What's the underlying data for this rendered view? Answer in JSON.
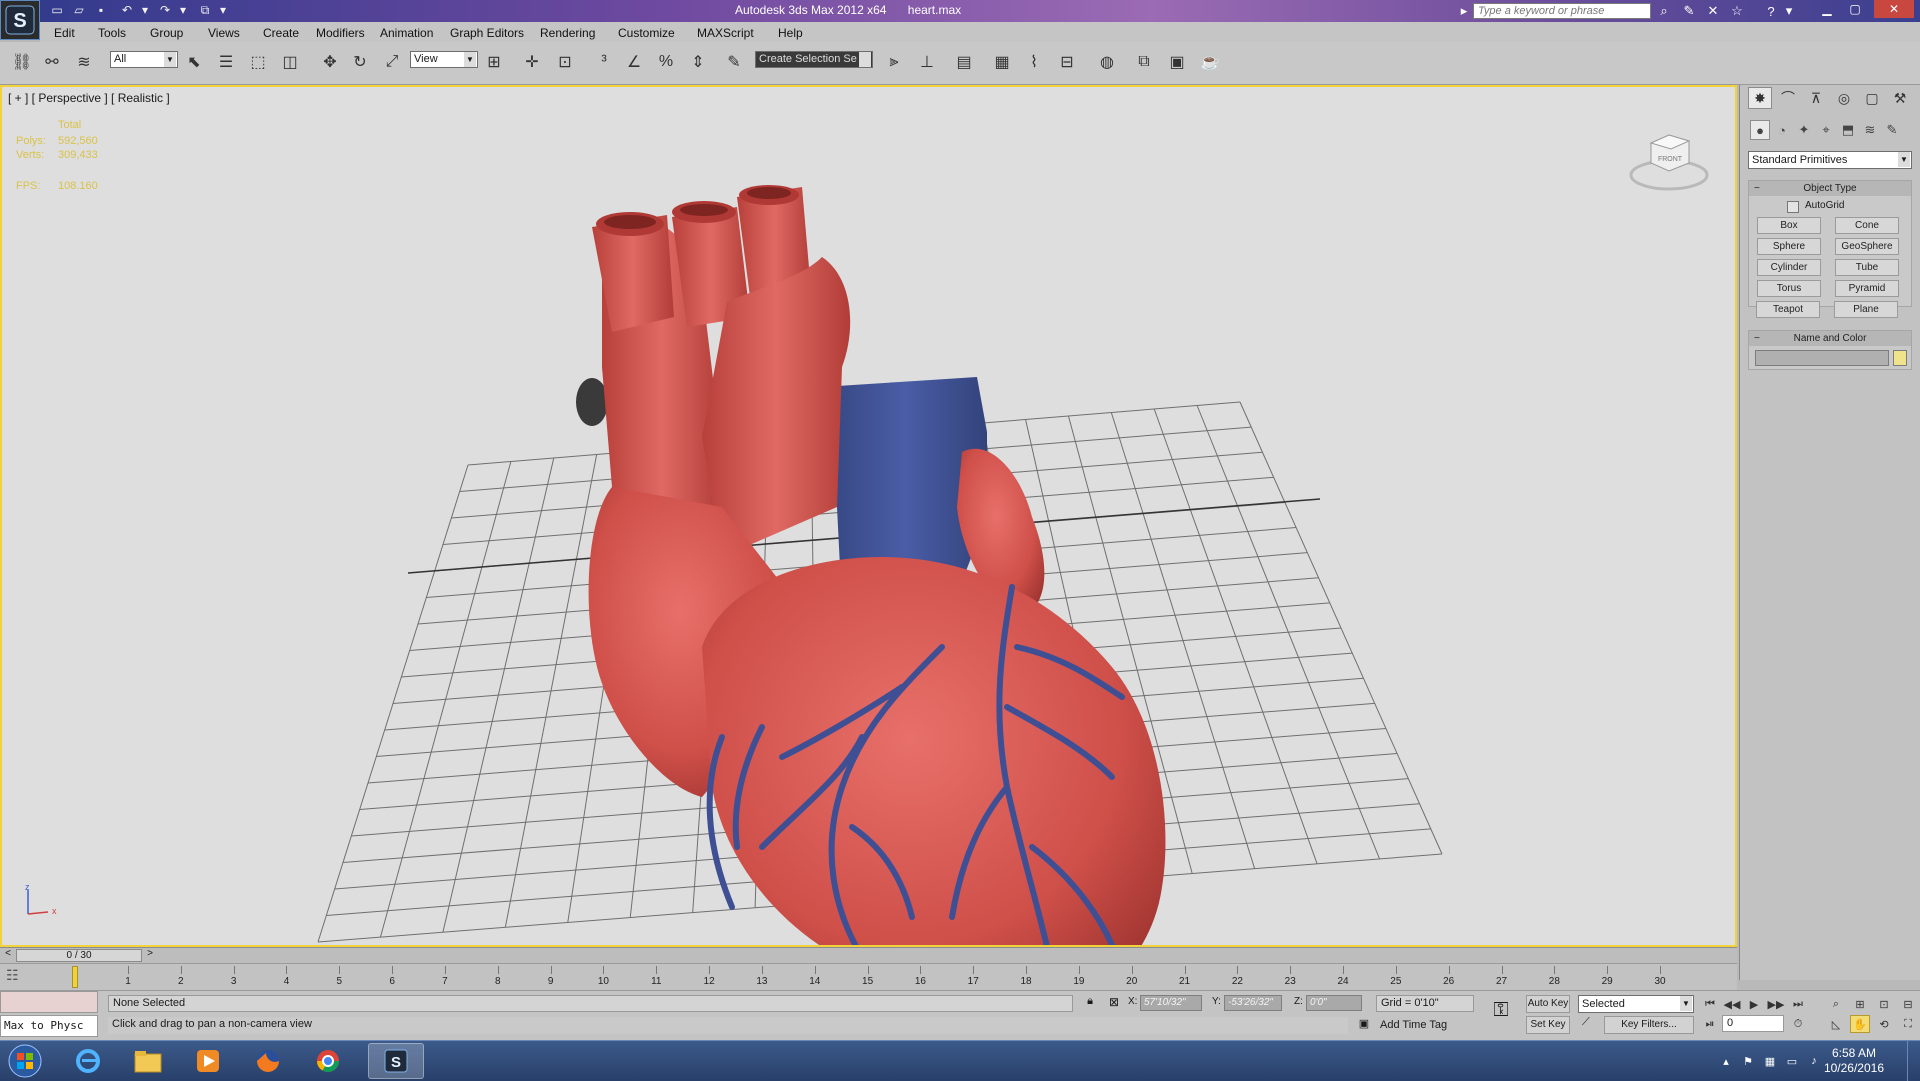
{
  "titlebar": {
    "app_title": "Autodesk 3ds Max  2012 x64",
    "file_name": "heart.max",
    "search_placeholder": "Type a keyword or phrase"
  },
  "menu": [
    "Edit",
    "Tools",
    "Group",
    "Views",
    "Create",
    "Modifiers",
    "Animation",
    "Graph Editors",
    "Rendering",
    "Customize",
    "MAXScript",
    "Help"
  ],
  "toolbar": {
    "selection_filter": "All",
    "reference_coord": "View",
    "named_selection": "Create Selection Se"
  },
  "viewport": {
    "label": "[ + ] [ Perspective ] [ Realistic ]",
    "stats": {
      "total_label": "Total",
      "polys_label": "Polys:",
      "polys_value": "592,560",
      "verts_label": "Verts:",
      "verts_value": "309,433",
      "fps_label": "FPS:",
      "fps_value": "108.160"
    },
    "viewcube_face": "FRONT",
    "axis": {
      "z": "z",
      "x": "x"
    }
  },
  "command_panel": {
    "category": "Standard Primitives",
    "object_type_title": "Object Type",
    "autogrid_label": "AutoGrid",
    "autogrid_checked": false,
    "primitives": [
      "Box",
      "Cone",
      "Sphere",
      "GeoSphere",
      "Cylinder",
      "Tube",
      "Torus",
      "Pyramid",
      "Teapot",
      "Plane"
    ],
    "name_color_title": "Name and Color",
    "name_value": "",
    "color_swatch": "#f0e48a"
  },
  "timeline": {
    "frame_display": "0 / 30",
    "prev": "<",
    "next": ">",
    "ticks": [
      "1",
      "2",
      "3",
      "4",
      "5",
      "6",
      "7",
      "8",
      "9",
      "10",
      "11",
      "12",
      "13",
      "14",
      "15",
      "16",
      "17",
      "18",
      "19",
      "20",
      "21",
      "22",
      "23",
      "24",
      "25",
      "26",
      "27",
      "28",
      "29",
      "30"
    ]
  },
  "status": {
    "maxscript_listener": "Max to Physc",
    "selection_status": "None Selected",
    "prompt": "Click and drag to pan a non-camera view",
    "x_label": "X:",
    "x_value": "57'10/32\"",
    "y_label": "Y:",
    "y_value": "-53'26/32\"",
    "z_label": "Z:",
    "z_value": "0'0\"",
    "grid": "Grid = 0'10\"",
    "add_time_tag": "Add Time Tag",
    "auto_key": "Auto Key",
    "set_key": "Set Key",
    "key_mode": "Selected",
    "key_filters": "Key Filters...",
    "current_frame": "0"
  },
  "taskbar": {
    "time": "6:58 AM",
    "date": "10/26/2016"
  },
  "colors": {
    "accent_yellow": "#f0d23a",
    "heart_red": "#d4554f",
    "vessel_blue": "#3e4f92"
  }
}
